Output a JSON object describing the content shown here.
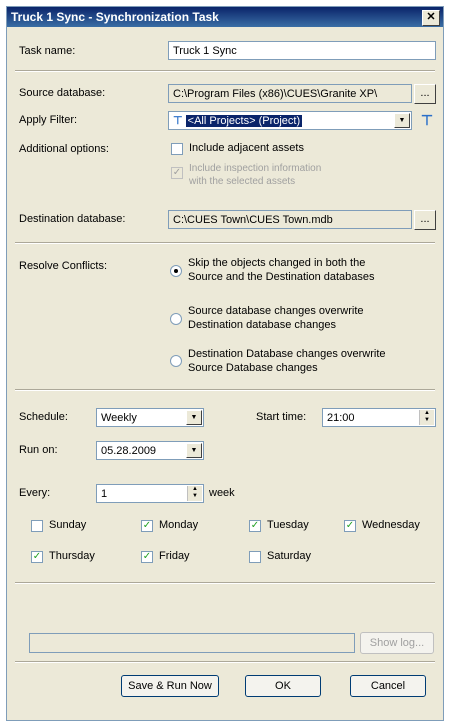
{
  "window": {
    "title": "Truck 1 Sync - Synchronization Task",
    "close": "✕"
  },
  "task_name": {
    "label": "Task name:",
    "value": "Truck 1 Sync"
  },
  "source_db": {
    "label": "Source database:",
    "value": "C:\\Program Files (x86)\\CUES\\Granite XP\\",
    "browse": "..."
  },
  "apply_filter": {
    "label": "Apply Filter:",
    "value": "<All Projects> (Project)"
  },
  "additional": {
    "label": "Additional options:",
    "include_adjacent": "Include adjacent assets",
    "include_inspection_line1": "Include inspection information",
    "include_inspection_line2": "with the selected assets"
  },
  "dest_db": {
    "label": "Destination database:",
    "value": "C:\\CUES Town\\CUES Town.mdb",
    "browse": "..."
  },
  "resolve": {
    "label": "Resolve Conflicts:",
    "opt1_line1": "Skip the objects changed in both the",
    "opt1_line2": "Source and the Destination databases",
    "opt2_line1": "Source database changes overwrite",
    "opt2_line2": "Destination database changes",
    "opt3_line1": "Destination Database changes overwrite",
    "opt3_line2": "Source Database changes"
  },
  "schedule": {
    "label": "Schedule:",
    "value": "Weekly",
    "start_label": "Start time:",
    "start_value": "21:00",
    "run_on_label": "Run on:",
    "run_on_value": "05.28.2009",
    "every_label": "Every:",
    "every_value": "1",
    "every_unit": "week"
  },
  "days": {
    "sunday": "Sunday",
    "monday": "Monday",
    "tuesday": "Tuesday",
    "wednesday": "Wednesday",
    "thursday": "Thursday",
    "friday": "Friday",
    "saturday": "Saturday"
  },
  "buttons": {
    "show_log": "Show log...",
    "save_run": "Save & Run Now",
    "ok": "OK",
    "cancel": "Cancel"
  }
}
